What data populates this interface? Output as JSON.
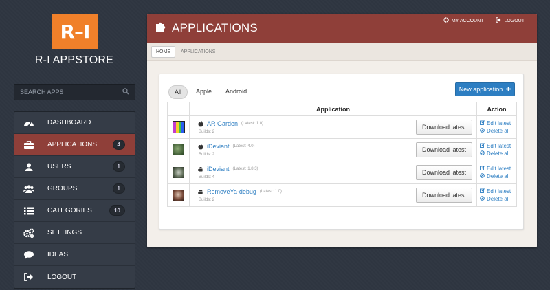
{
  "logo": {
    "text": "R–I"
  },
  "store_name": "R-I APPSTORE",
  "search": {
    "placeholder": "SEARCH APPS"
  },
  "nav": {
    "items": [
      {
        "label": "DASHBOARD",
        "icon": "dashboard-icon",
        "badge": ""
      },
      {
        "label": "APPLICATIONS",
        "icon": "briefcase-icon",
        "badge": "4"
      },
      {
        "label": "USERS",
        "icon": "user-icon",
        "badge": "1"
      },
      {
        "label": "GROUPS",
        "icon": "group-icon",
        "badge": "1"
      },
      {
        "label": "CATEGORIES",
        "icon": "list-icon",
        "badge": "10"
      },
      {
        "label": "SETTINGS",
        "icon": "gears-icon",
        "badge": ""
      },
      {
        "label": "IDEAS",
        "icon": "speech-bubble-icon",
        "badge": ""
      },
      {
        "label": "LOGOUT",
        "icon": "sign-out-icon",
        "badge": ""
      }
    ]
  },
  "header": {
    "title": "APPLICATIONS",
    "my_account": "MY ACCOUNT",
    "logout": "LOGOUT"
  },
  "breadcrumb": {
    "home": "HOME",
    "current": "APPLICATIONS"
  },
  "filters": {
    "all": "All",
    "apple": "Apple",
    "android": "Android"
  },
  "new_application": "New application",
  "table": {
    "col_application": "Application",
    "col_action": "Action",
    "rows": [
      {
        "name": "AR Garden",
        "platform": "apple-icon",
        "latest": "(Latest: 1.0)",
        "builds": "Builds: 2",
        "download": "Download latest",
        "edit": "Edit latest",
        "delete": "Delete all"
      },
      {
        "name": "iDeviant",
        "platform": "apple-icon",
        "latest": "(Latest: 4.0)",
        "builds": "Builds: 2",
        "download": "Download latest",
        "edit": "Edit latest",
        "delete": "Delete all"
      },
      {
        "name": "iDeviant",
        "platform": "android-icon",
        "latest": "(Latest: 1.8.3)",
        "builds": "Builds: 4",
        "download": "Download latest",
        "edit": "Edit latest",
        "delete": "Delete all"
      },
      {
        "name": "RemoveYa-debug",
        "platform": "android-icon",
        "latest": "(Latest: 1.0)",
        "builds": "Builds: 2",
        "download": "Download latest",
        "edit": "Edit latest",
        "delete": "Delete all"
      }
    ]
  },
  "colors": {
    "accent": "#8f3f39",
    "logo": "#f0802a",
    "link": "#2d7ec2"
  }
}
